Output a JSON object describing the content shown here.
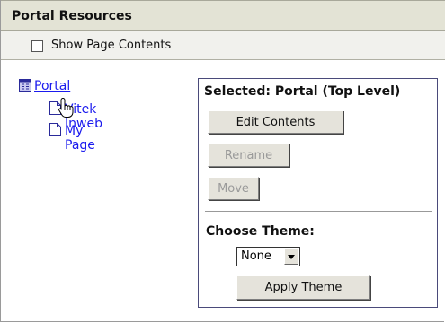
{
  "header": {
    "title": "Portal Resources"
  },
  "options": {
    "show_page_contents_label": "Show Page Contents",
    "show_page_contents_checked": false
  },
  "tree": {
    "root": {
      "label": "Portal",
      "icon": "site-icon"
    },
    "children": [
      {
        "label": "Vitek Inweb",
        "icon": "page-icon"
      },
      {
        "label": "My Page",
        "icon": "page-icon"
      }
    ]
  },
  "panel": {
    "title": "Selected: Portal (Top Level)",
    "edit_label": "Edit Contents",
    "rename_label": "Rename",
    "move_label": "Move",
    "theme_label": "Choose Theme:",
    "theme_value": "None",
    "apply_label": "Apply Theme"
  },
  "colors": {
    "header_bg": "#e3e3d5",
    "link": "#1a1aee",
    "panel_border": "#4a4a7a"
  }
}
